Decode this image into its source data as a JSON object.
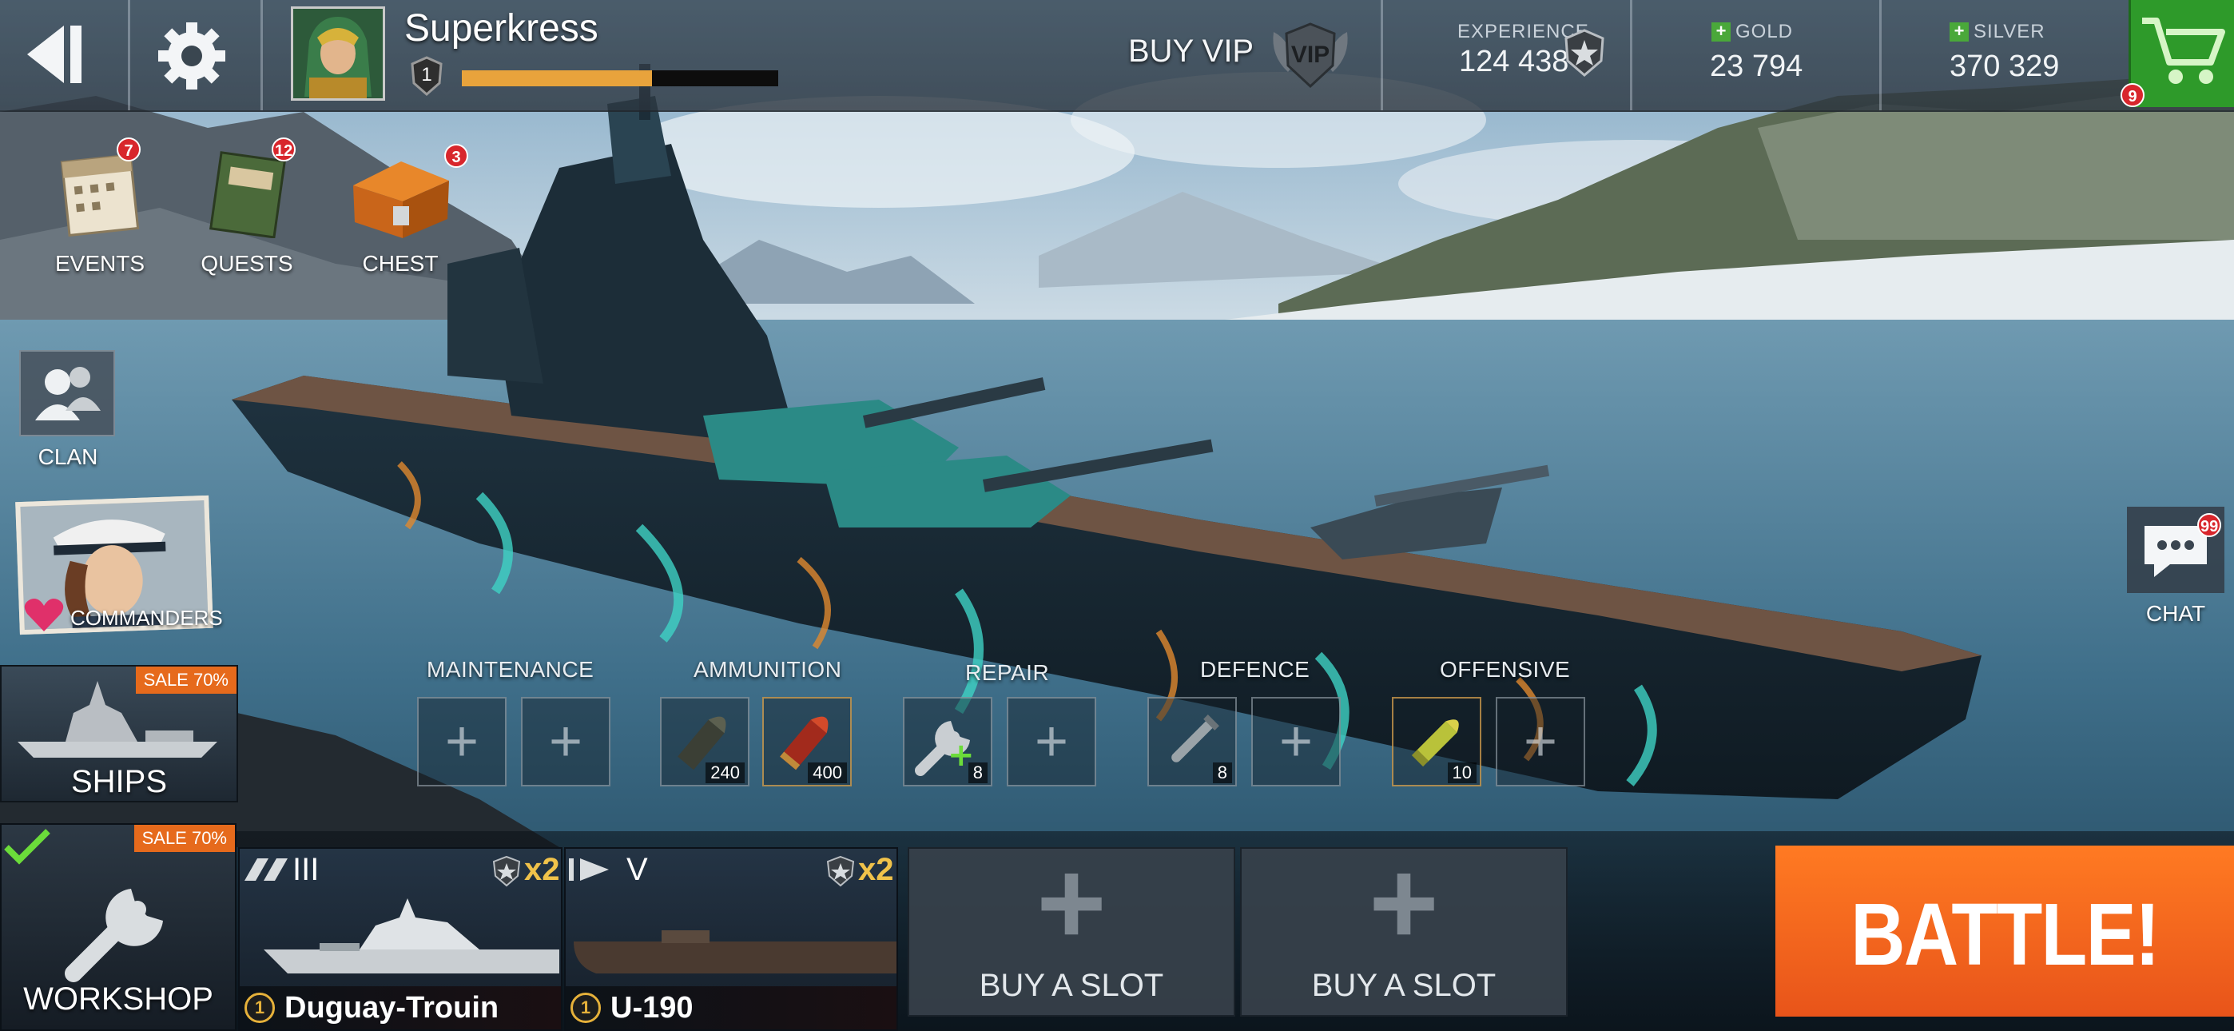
{
  "player": {
    "name": "Superkress",
    "level": "1",
    "xp_progress": 0.6
  },
  "vip": {
    "label": "BUY VIP",
    "badge": "VIP"
  },
  "stats": {
    "experience": {
      "label": "EXPERIENCE",
      "value": "124 438"
    },
    "gold": {
      "label": "GOLD",
      "value": "23 794"
    },
    "silver": {
      "label": "SILVER",
      "value": "370 329"
    }
  },
  "shop": {
    "badge": "9"
  },
  "menu": {
    "events": {
      "label": "EVENTS",
      "badge": "7"
    },
    "quests": {
      "label": "QUESTS",
      "badge": "12"
    },
    "chest": {
      "label": "CHEST",
      "badge": "3"
    },
    "clan": {
      "label": "CLAN"
    },
    "commanders": {
      "label": "COMMANDERS"
    },
    "chat": {
      "label": "CHAT",
      "badge": "99"
    }
  },
  "consumables": {
    "maintenance": {
      "label": "MAINTENANCE"
    },
    "ammunition": {
      "label": "AMMUNITION",
      "counts": [
        "240",
        "400"
      ]
    },
    "repair": {
      "label": "REPAIR",
      "count": "8"
    },
    "defence": {
      "label": "DEFENCE",
      "count": "8"
    },
    "offensive": {
      "label": "OFFENSIVE",
      "count": "10"
    }
  },
  "ships_panel": {
    "label": "SHIPS",
    "sale": "SALE 70%"
  },
  "workshop": {
    "label": "WORKSHOP",
    "sale": "SALE 70%"
  },
  "ship_cards": [
    {
      "tier": "III",
      "name": "Duguay-Trouin",
      "level": "1",
      "multiplier": "x2"
    },
    {
      "tier": "V",
      "name": "U-190",
      "level": "1",
      "multiplier": "x2"
    }
  ],
  "buy_slots": [
    "BUY A SLOT",
    "BUY A SLOT"
  ],
  "battle": {
    "label": "BATTLE!"
  },
  "colors": {
    "battle": "#ff6a1a",
    "sale": "#e66a1c",
    "badge": "#d8262c",
    "shop": "#2e9a2a",
    "accent_gold": "#e8a33c"
  }
}
